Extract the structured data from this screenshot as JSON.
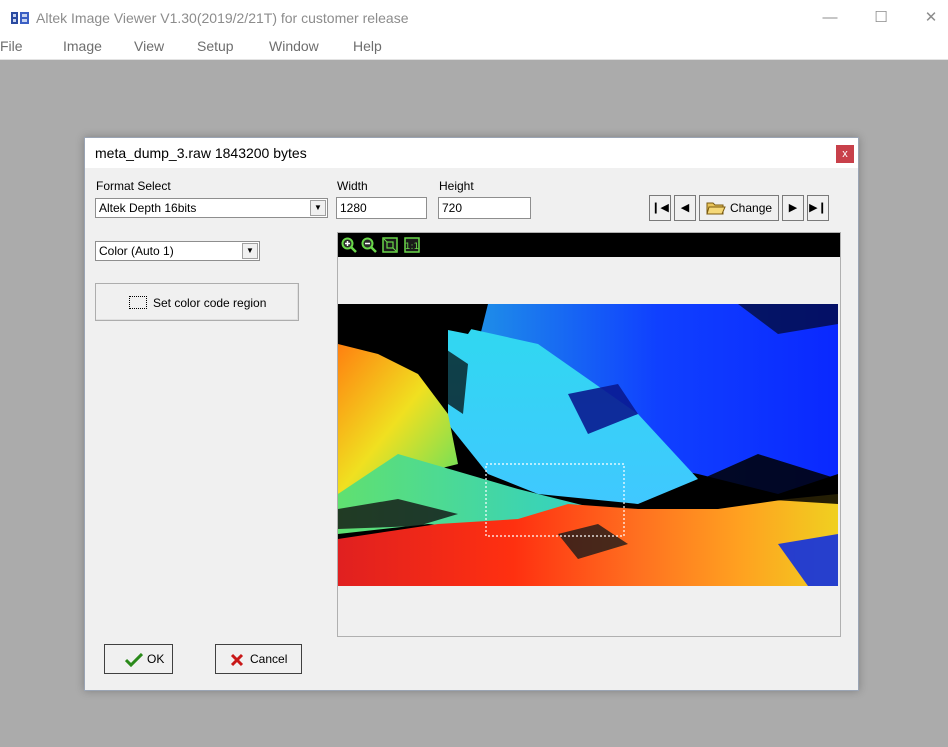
{
  "window": {
    "title": "Altek Image Viewer V1.30(2019/2/21T)  for customer release",
    "minimize_glyph": "—",
    "maximize_glyph": "☐",
    "close_glyph": "✕"
  },
  "menu": [
    {
      "label": "File"
    },
    {
      "label": "Image"
    },
    {
      "label": "View"
    },
    {
      "label": "Setup"
    },
    {
      "label": "Window"
    },
    {
      "label": "Help"
    }
  ],
  "dialog": {
    "title": "meta_dump_3.raw 1843200 bytes",
    "close_glyph": "x",
    "format_label": "Format Select",
    "format_value": "Altek Depth 16bits",
    "width_label": "Width",
    "width_value": "1280",
    "height_label": "Height",
    "height_value": "720",
    "color_mode_value": "Color (Auto 1)",
    "region_button_label": "Set color code region",
    "change_button_label": "Change",
    "ok_label": "OK",
    "cancel_label": "Cancel"
  },
  "icons": {
    "app": "app-icon",
    "zoom_in": "zoom-in-icon",
    "zoom_out": "zoom-out-icon",
    "fit": "fit-window-icon",
    "actual_size": "actual-size-icon"
  }
}
